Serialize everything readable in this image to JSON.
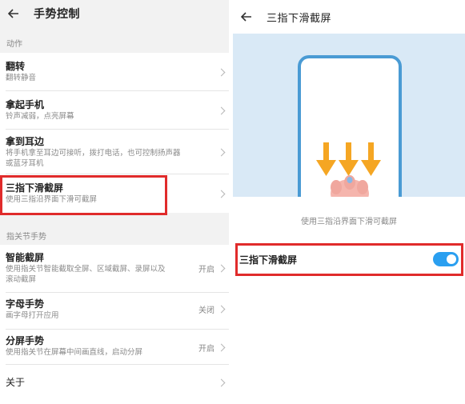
{
  "left": {
    "header_title": "手势控制",
    "section_actions": "动作",
    "items": [
      {
        "title": "翻转",
        "sub": "翻转静音"
      },
      {
        "title": "拿起手机",
        "sub": "铃声减弱，点亮屏幕"
      },
      {
        "title": "拿到耳边",
        "sub": "将手机拿至耳边可接听，拨打电话，也可控制扬声器",
        "sub2": "或蓝牙耳机"
      },
      {
        "title": "三指下滑截屏",
        "sub": "使用三指沿界面下滑可截屏"
      }
    ],
    "section_knuckle": "指关节手势",
    "knuckle_items": [
      {
        "title": "智能截屏",
        "sub": "使用指关节智能截取全屏、区域截屏、录屏以及",
        "sub2": "滚动截屏",
        "status": "开启"
      },
      {
        "title": "字母手势",
        "sub": "画字母打开应用",
        "status": "关闭"
      },
      {
        "title": "分屏手势",
        "sub": "使用指关节在屏幕中间画直线，启动分屏",
        "status": "开启"
      }
    ],
    "about": "关于"
  },
  "right": {
    "header_title": "三指下滑截屏",
    "caption": "使用三指沿界面下滑可截屏",
    "toggle_label": "三指下滑截屏",
    "toggle_on": true
  },
  "colors": {
    "highlight": "#e02b2b",
    "accent": "#2a9ff0",
    "arrow": "#f5a623",
    "illustration_bg": "#d9e9f6"
  },
  "icons": [
    "back-arrow-icon",
    "chevron-right-icon",
    "toggle-switch",
    "phone-illustration",
    "down-arrow-icon",
    "hand-icon"
  ]
}
